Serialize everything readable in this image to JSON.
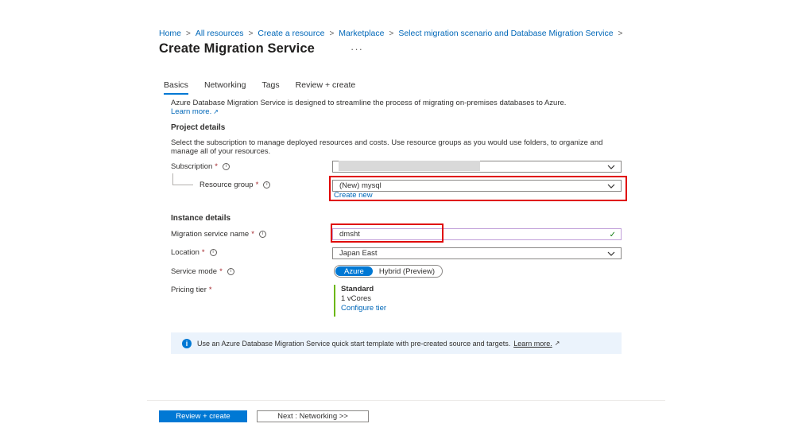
{
  "breadcrumb": [
    "Home",
    "All resources",
    "Create a resource",
    "Marketplace",
    "Select migration scenario and Database Migration Service"
  ],
  "breadcrumb_separator": ">",
  "page": {
    "title": "Create Migration Service",
    "more": "···"
  },
  "tabs": [
    "Basics",
    "Networking",
    "Tags",
    "Review + create"
  ],
  "intro": {
    "text": "Azure Database Migration Service is designed to streamline the process of migrating on-premises databases to Azure.",
    "learn_more": "Learn more."
  },
  "project": {
    "title": "Project details",
    "description": "Select the subscription to manage deployed resources and costs. Use resource groups as you would use folders, to organize and manage all of your resources.",
    "subscription_label": "Subscription",
    "resource_group_label": "Resource group",
    "resource_group_value": "(New) mysql",
    "create_new": "Create new"
  },
  "instance": {
    "title": "Instance details",
    "name_label": "Migration service name",
    "name_value": "dmsht",
    "location_label": "Location",
    "location_value": "Japan East",
    "mode_label": "Service mode",
    "mode_options": [
      "Azure",
      "Hybrid (Preview)"
    ],
    "pricing_label": "Pricing tier",
    "pricing_tier": "Standard",
    "pricing_cores": "1 vCores",
    "configure": "Configure tier"
  },
  "required_mark": "*",
  "info_bar": {
    "text": "Use an Azure Database Migration Service quick start template with pre-created source and targets.",
    "link": "Learn more."
  },
  "buttons": {
    "review": "Review + create",
    "next": "Next : Networking >>"
  },
  "colors": {
    "accent": "#0078d4",
    "highlight": "#e00000",
    "pricing_bar": "#6bb700",
    "info_bg": "#ebf3fc"
  }
}
